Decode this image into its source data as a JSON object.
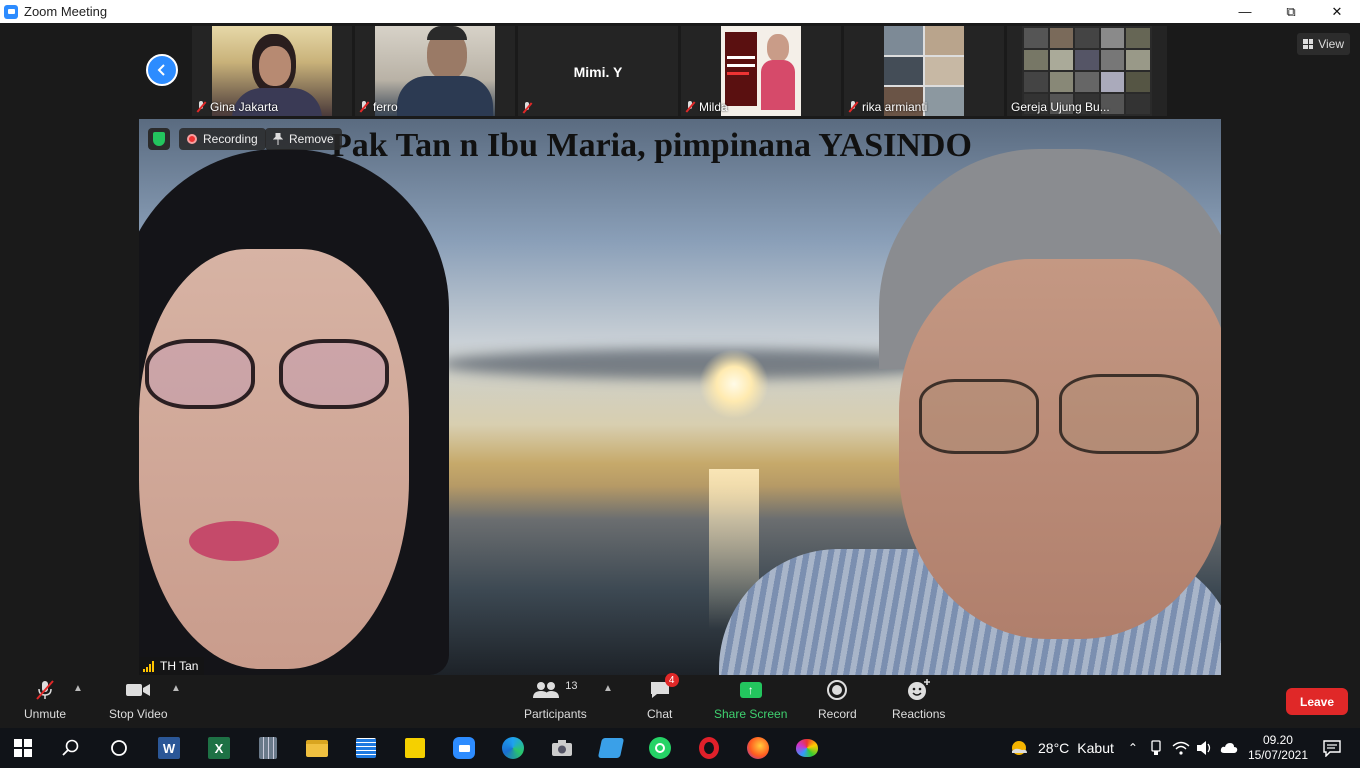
{
  "window": {
    "title": "Zoom Meeting",
    "controls": [
      "minimize",
      "restore",
      "close"
    ]
  },
  "thumbnails": [
    {
      "name": "Gina Jakarta",
      "muted": true,
      "has_video": true
    },
    {
      "name": "ferro",
      "muted": true,
      "has_video": true
    },
    {
      "name": "Mimi. Y",
      "muted": true,
      "has_video": false
    },
    {
      "name": "Milda",
      "muted": true,
      "has_video": true
    },
    {
      "name": "rika armianti",
      "muted": true,
      "has_video": true
    },
    {
      "name": "Gereja Ujung Bu...",
      "muted": false,
      "has_video": true
    }
  ],
  "view_button": {
    "label": "View"
  },
  "main_video": {
    "overlay_text": "Pak Tan n Ibu Maria, pimpinana YASINDO",
    "recording_label": "Recording",
    "remove_label": "Remove",
    "speaker_name": "TH Tan"
  },
  "toolbar": {
    "unmute": "Unmute",
    "stop_video": "Stop Video",
    "participants": "Participants",
    "participants_count": "13",
    "chat": "Chat",
    "chat_badge": "4",
    "share_screen": "Share Screen",
    "record": "Record",
    "reactions": "Reactions",
    "leave": "Leave"
  },
  "taskbar": {
    "weather_temp": "28°C",
    "weather_desc": "Kabut",
    "time": "09.20",
    "date": "15/07/2021"
  },
  "colors": {
    "zoom_blue": "#2d8cff",
    "leave_red": "#e02828",
    "share_green": "#23c55e"
  }
}
